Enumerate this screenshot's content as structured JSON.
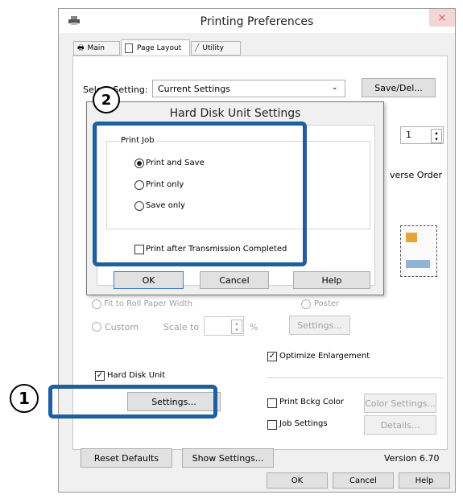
{
  "window": {
    "title": "Printing Preferences",
    "close_label": "×"
  },
  "tabs": [
    {
      "label": "Main"
    },
    {
      "label": "Page Layout"
    },
    {
      "label": "Utility"
    }
  ],
  "select_setting": {
    "label": "Select Setting:",
    "value": "Current Settings",
    "button": "Save/Del..."
  },
  "copies_value": "1",
  "reverse_order_partial": "verse Order",
  "behind_options": {
    "fit_roll": "Fit to Roll Paper Width",
    "custom": "Custom",
    "scale_to": "Scale to",
    "percent": "%",
    "poster": "Poster",
    "poster_settings": "Settings..."
  },
  "optimize_enlargement": "Optimize Enlargement",
  "hard_disk_unit": {
    "label": "Hard Disk Unit",
    "settings_button": "Settings..."
  },
  "print_bckg_color": "Print Bckg Color",
  "color_settings_button": "Color Settings...",
  "job_settings": "Job Settings",
  "details_button": "Details...",
  "bottom": {
    "reset": "Reset Defaults",
    "show": "Show Settings...",
    "version": "Version 6.70"
  },
  "footer": {
    "ok": "OK",
    "cancel": "Cancel",
    "help": "Help"
  },
  "dialog": {
    "title": "Hard Disk Unit Settings",
    "group_label": "Print Job",
    "options": [
      {
        "label": "Print and Save",
        "selected": true
      },
      {
        "label": "Print only",
        "selected": false
      },
      {
        "label": "Save only",
        "selected": false
      }
    ],
    "after_transmission": "Print after Transmission Completed",
    "ok": "OK",
    "cancel": "Cancel",
    "help": "Help"
  },
  "callouts": {
    "one": "1",
    "two": "2"
  },
  "colors": {
    "highlight": "#1e5f9e",
    "window_bg": "#f0f0f0",
    "dialog_border": "#7a7a7a"
  }
}
